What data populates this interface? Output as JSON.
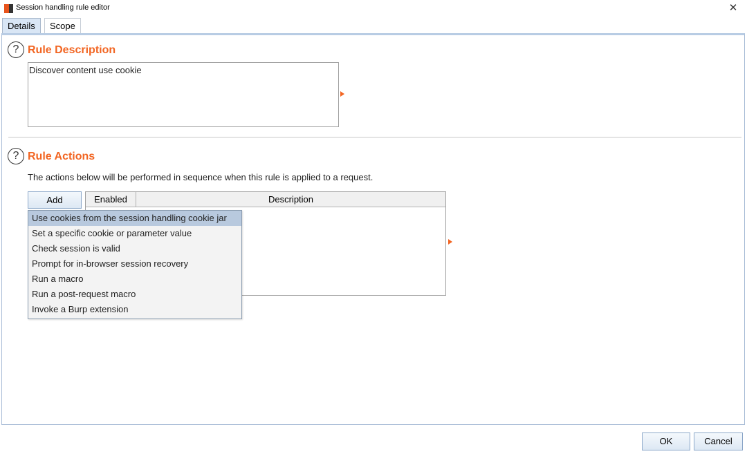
{
  "window": {
    "title": "Session handling rule editor",
    "close_glyph": "✕"
  },
  "tabs": [
    {
      "label": "Details",
      "active": true
    },
    {
      "label": "Scope",
      "active": false
    }
  ],
  "rule_description": {
    "title": "Rule Description",
    "help_glyph": "?",
    "value": "Discover content use cookie"
  },
  "rule_actions": {
    "title": "Rule Actions",
    "help_glyph": "?",
    "description": "The actions below will be performed in sequence when this rule is applied to a request.",
    "add_label": "Add",
    "table": {
      "columns": [
        "Enabled",
        "Description"
      ],
      "rows": []
    },
    "add_menu": {
      "items": [
        {
          "label": "Use cookies from the session handling cookie jar",
          "selected": true
        },
        {
          "label": "Set a specific cookie or parameter value",
          "selected": false
        },
        {
          "label": "Check session is valid",
          "selected": false
        },
        {
          "label": "Prompt for in-browser session recovery",
          "selected": false
        },
        {
          "label": "Run a macro",
          "selected": false
        },
        {
          "label": "Run a post-request macro",
          "selected": false
        },
        {
          "label": "Invoke a Burp extension",
          "selected": false
        }
      ]
    }
  },
  "footer": {
    "ok_label": "OK",
    "cancel_label": "Cancel"
  },
  "colors": {
    "accent": "#f26522",
    "selection": "#b8c9de",
    "active_tab": "#d9e6f5"
  }
}
